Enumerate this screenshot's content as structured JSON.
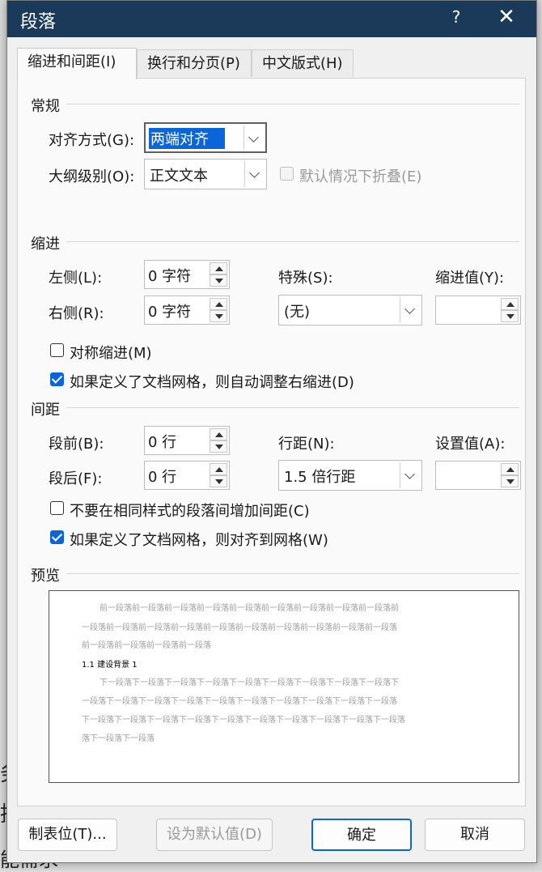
{
  "dialog": {
    "title": "段落",
    "help": "?",
    "close": "✕"
  },
  "tabs": [
    {
      "label": "缩进和间距(I)",
      "active": true
    },
    {
      "label": "换行和分页(P)",
      "active": false
    },
    {
      "label": "中文版式(H)",
      "active": false
    }
  ],
  "general": {
    "title": "常规",
    "align_label": "对齐方式(G):",
    "align_value": "两端对齐",
    "outline_label": "大纲级别(O):",
    "outline_value": "正文文本",
    "collapse_label": "默认情况下折叠(E)"
  },
  "indent": {
    "title": "缩进",
    "left_label": "左侧(L):",
    "left_value": "0 字符",
    "right_label": "右侧(R):",
    "right_value": "0 字符",
    "special_label": "特殊(S):",
    "special_value": "(无)",
    "by_label": "缩进值(Y):",
    "by_value": "",
    "mirror_label": "对称缩进(M)",
    "mirror_checked": false,
    "auto_label": "如果定义了文档网格，则自动调整右缩进(D)",
    "auto_checked": true
  },
  "spacing": {
    "title": "间距",
    "before_label": "段前(B):",
    "before_value": "0 行",
    "after_label": "段后(F):",
    "after_value": "0 行",
    "line_label": "行距(N):",
    "line_value": "1.5 倍行距",
    "at_label": "设置值(A):",
    "at_value": "",
    "no_add_label": "不要在相同样式的段落间增加间距(C)",
    "no_add_checked": false,
    "snap_label": "如果定义了文档网格，则对齐到网格(W)",
    "snap_checked": true
  },
  "preview": {
    "title": "预览",
    "prev_lines": [
      "前一段落前一段落前一段落前一段落前一段落前一段落前一段落前一段落前一段落前",
      "一段落前一段落前一段落前一段落前一段落前一段落前一段落前一段落前一段落前一段落",
      "前一段落前一段落前一段落前一段落"
    ],
    "current_line": "1.1 建设背景 1",
    "next_lines": [
      "下一段落下一段落下一段落下一段落下一段落下一段落下一段落下一段落下一段落下",
      "一段落下一段落下一段落下一段落下一段落下一段落下一段落下一段落下一段落下一段落",
      "下一段落下一段落下一段落下一段落下一段落下一段落下一段落下一段落下一段落下一段落",
      "落下一段落下一段落"
    ]
  },
  "buttons": {
    "tabs": "制表位(T)...",
    "set_default": "设为默认值(D)",
    "ok": "确定",
    "cancel": "取消"
  },
  "background": {
    "bottom_text_1": "务",
    "bottom_text_2": "据",
    "bottom_text_3": "能需求"
  }
}
